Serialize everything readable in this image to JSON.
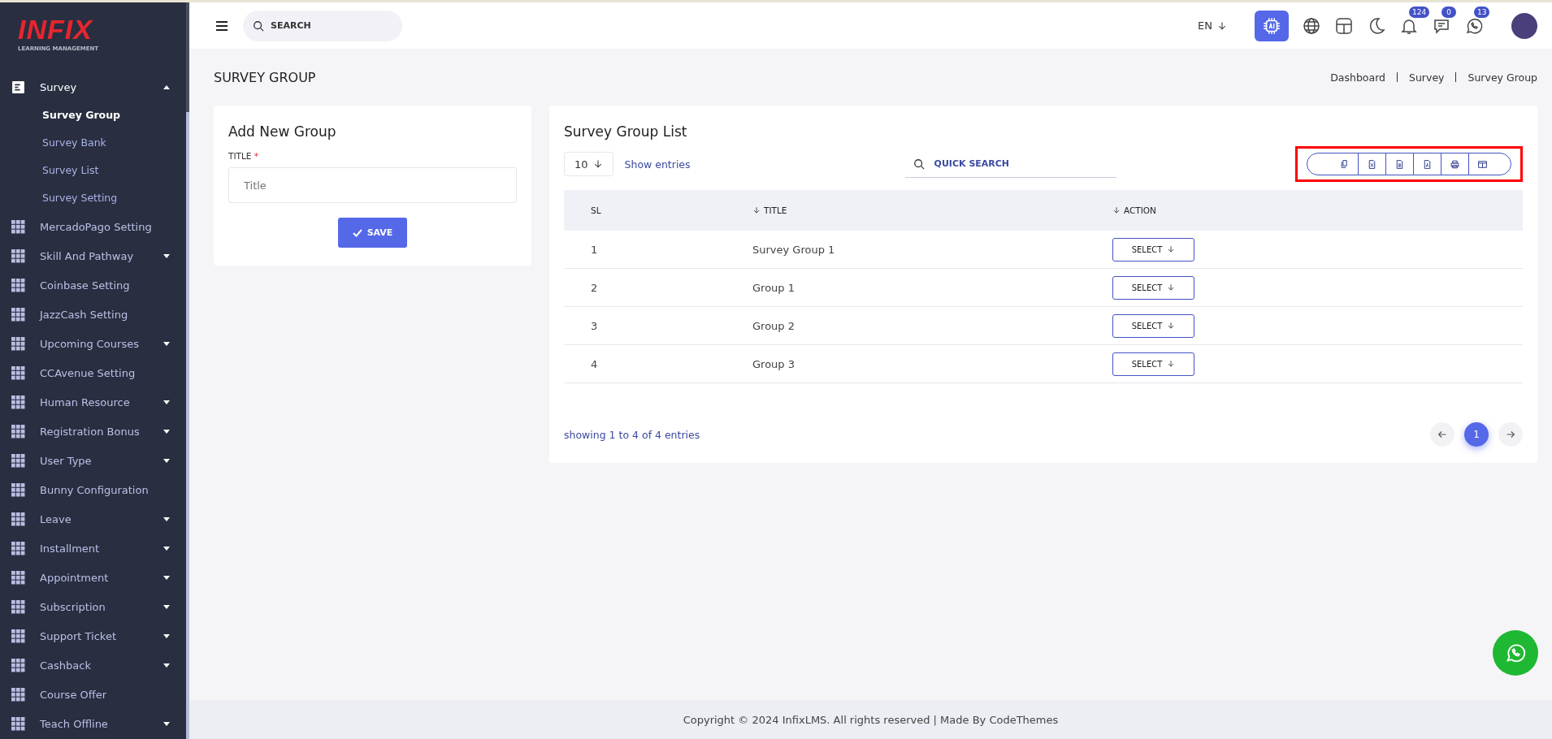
{
  "logo": {
    "brand": "INFIX",
    "tagline": "LEARNING MANAGEMENT"
  },
  "sidebar": {
    "items": [
      {
        "label": "Survey",
        "expandable": true,
        "expanded": true,
        "children": [
          {
            "label": "Survey Group",
            "selected": true
          },
          {
            "label": "Survey Bank",
            "selected": false
          },
          {
            "label": "Survey List",
            "selected": false
          },
          {
            "label": "Survey Setting",
            "selected": false
          }
        ]
      },
      {
        "label": "MercadoPago Setting",
        "expandable": false,
        "expanded": false
      },
      {
        "label": "Skill And Pathway",
        "expandable": true,
        "expanded": false
      },
      {
        "label": "Coinbase Setting",
        "expandable": false,
        "expanded": false
      },
      {
        "label": "JazzCash Setting",
        "expandable": false,
        "expanded": false
      },
      {
        "label": "Upcoming Courses",
        "expandable": true,
        "expanded": false
      },
      {
        "label": "CCAvenue Setting",
        "expandable": false,
        "expanded": false
      },
      {
        "label": "Human Resource",
        "expandable": true,
        "expanded": false
      },
      {
        "label": "Registration Bonus",
        "expandable": true,
        "expanded": false
      },
      {
        "label": "User Type",
        "expandable": true,
        "expanded": false
      },
      {
        "label": "Bunny Configuration",
        "expandable": false,
        "expanded": false
      },
      {
        "label": "Leave",
        "expandable": true,
        "expanded": false
      },
      {
        "label": "Installment",
        "expandable": true,
        "expanded": false
      },
      {
        "label": "Appointment",
        "expandable": true,
        "expanded": false
      },
      {
        "label": "Subscription",
        "expandable": true,
        "expanded": false
      },
      {
        "label": "Support Ticket",
        "expandable": true,
        "expanded": false
      },
      {
        "label": "Cashback",
        "expandable": true,
        "expanded": false
      },
      {
        "label": "Course Offer",
        "expandable": false,
        "expanded": false
      },
      {
        "label": "Teach Offline",
        "expandable": true,
        "expanded": false
      }
    ]
  },
  "header": {
    "search": {
      "placeholder": "SEARCH"
    },
    "language": "EN",
    "badges": [
      {
        "kind": "bell",
        "count": "124"
      },
      {
        "kind": "chat",
        "count": "0"
      },
      {
        "kind": "whatsapp",
        "count": "13"
      }
    ]
  },
  "page": {
    "title": "SURVEY GROUP",
    "breadcrumb": [
      "Dashboard",
      "Survey",
      "Survey Group"
    ]
  },
  "form": {
    "title": "Add New Group",
    "field_label": "TITLE",
    "required_mark": "*",
    "placeholder": "Title",
    "save_button": "SAVE"
  },
  "list": {
    "title": "Survey Group List",
    "page_size": "10",
    "show_entries": "Show entries",
    "search_placeholder": "QUICK SEARCH",
    "export_highlighted": true,
    "export_buttons": [
      {
        "kind": "copy"
      },
      {
        "kind": "excel"
      },
      {
        "kind": "csv"
      },
      {
        "kind": "pdf"
      },
      {
        "kind": "print"
      },
      {
        "kind": "columns"
      }
    ],
    "columns": [
      {
        "label": "SL",
        "sortable": false
      },
      {
        "label": "TITLE",
        "sortable": true
      },
      {
        "label": "ACTION",
        "sortable": true
      }
    ],
    "rows": [
      {
        "sl": "1",
        "title": "Survey Group 1",
        "action": "SELECT"
      },
      {
        "sl": "2",
        "title": "Group 1",
        "action": "SELECT"
      },
      {
        "sl": "3",
        "title": "Group 2",
        "action": "SELECT"
      },
      {
        "sl": "4",
        "title": "Group 3",
        "action": "SELECT"
      }
    ],
    "summary": "showing 1 to 4 of 4 entries",
    "pages": [
      {
        "label": "1",
        "selected": true
      }
    ]
  },
  "footer": "Copyright © 2024 InfixLMS. All rights reserved | Made By CodeThemes"
}
